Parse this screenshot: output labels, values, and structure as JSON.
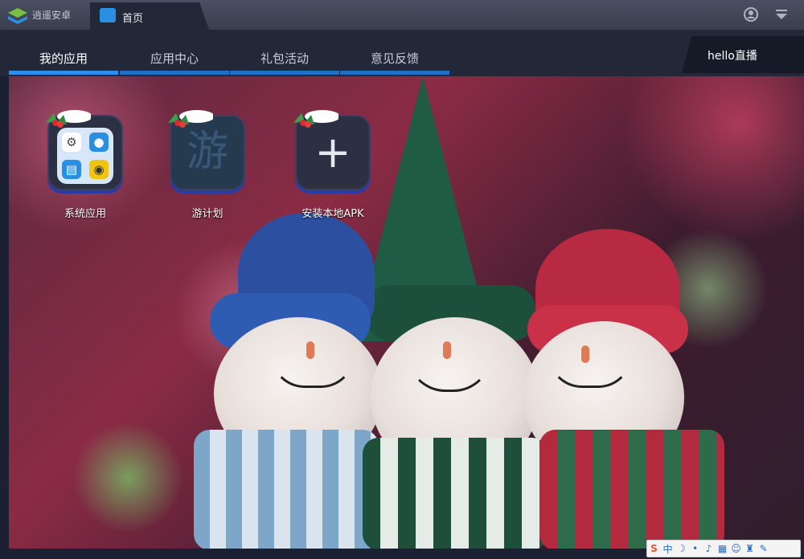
{
  "titlebar": {
    "app_name": "逍遥安卓",
    "home_tab": "首页"
  },
  "nav": {
    "tabs": [
      {
        "label": "我的应用",
        "active": true
      },
      {
        "label": "应用中心",
        "active": false
      },
      {
        "label": "礼包活动",
        "active": false
      },
      {
        "label": "意见反馈",
        "active": false
      }
    ],
    "live": "hello直播"
  },
  "apps": [
    {
      "label": "系统应用"
    },
    {
      "label": "游计划"
    },
    {
      "label": "安装本地APK"
    }
  ],
  "game_glyph": "游",
  "tray": {
    "ime": "S",
    "lang": "中",
    "icons": [
      "moon-icon",
      "dot-icon",
      "mic-icon",
      "keyboard-icon",
      "person-icon",
      "shirt-icon",
      "wrench-icon"
    ]
  },
  "colors": {
    "accent": "#2b8ef0",
    "nav_bg": "#232839",
    "titlebar_bg": "#3a3f4f"
  }
}
